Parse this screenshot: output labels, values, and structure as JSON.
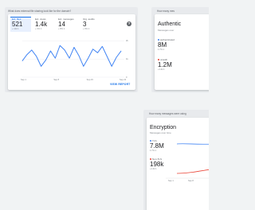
{
  "colors": {
    "accent": "#1a73e8",
    "line_blue": "#4285f4",
    "line_red": "#ea4335",
    "chip_bg": "#e8f0fe"
  },
  "card_a": {
    "question": "What does external file sharing look like for the domain?",
    "metrics": [
      {
        "label": "Ext. files",
        "value": "521",
        "delta": "+ 12k  1"
      },
      {
        "label": "Ext. views",
        "value": "1.4k",
        "delta": "+ 1%  1"
      },
      {
        "label": "Ext. messages",
        "value": "14",
        "delta": "+ 8%  1"
      },
      {
        "label": "Org. audits",
        "value": "3",
        "delta": "+ 0%  1"
      }
    ],
    "help_icon": "help-icon",
    "y_ticks": [
      "2k",
      "1k",
      "0"
    ],
    "x_ticks": [
      "Sep 1",
      "Sep 8",
      "Sep 15",
      "Sep 22"
    ],
    "view_report_label": "VIEW REPORT"
  },
  "card_b": {
    "question": "How many mes",
    "title": "Authentic",
    "subtitle": "Messages over",
    "stats": [
      {
        "label": "authenticated",
        "value": "8M",
        "delta": "1.7%  1"
      },
      {
        "label": "unauth",
        "value": "1.2M",
        "delta": "+1.4k  1"
      }
    ]
  },
  "card_c": {
    "question": "How many messages were using",
    "title": "Encryption",
    "subtitle": "Messages over time",
    "stats": [
      {
        "label": "TLS",
        "value": "7.8M",
        "delta": "1.7%  1"
      },
      {
        "label": "Non-TLS",
        "value": "198k",
        "delta": "+1.4k  1"
      }
    ],
    "x_ticks": [
      "Sep 1",
      "Sep 8"
    ]
  },
  "chart_data": {
    "type": "line",
    "x": [
      "Sep 1",
      "Sep 2",
      "Sep 3",
      "Sep 4",
      "Sep 5",
      "Sep 6",
      "Sep 7",
      "Sep 8",
      "Sep 9",
      "Sep 10",
      "Sep 11",
      "Sep 12",
      "Sep 13",
      "Sep 14",
      "Sep 15",
      "Sep 16",
      "Sep 17",
      "Sep 18",
      "Sep 19",
      "Sep 20",
      "Sep 21",
      "Sep 22"
    ],
    "series": [
      {
        "values": [
          900,
          1250,
          1500,
          1150,
          600,
          950,
          1450,
          1050,
          1750,
          1500,
          1050,
          1650,
          1200,
          600,
          1050,
          1550,
          1350,
          1700,
          1150,
          600,
          1100,
          1450
        ]
      }
    ],
    "ylim": [
      0,
      2200
    ],
    "yticks": [
      "2k",
      "1k",
      "0"
    ],
    "xlabel": "",
    "ylabel": ""
  }
}
